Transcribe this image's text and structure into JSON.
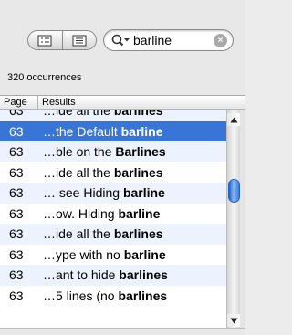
{
  "search": {
    "query": "barline"
  },
  "status": {
    "occurrences": "320 occurrences"
  },
  "table": {
    "headers": {
      "page": "Page",
      "results": "Results"
    },
    "rows": [
      {
        "page": "63",
        "pre": "…ide all the ",
        "bold": "barlines",
        "selected": false
      },
      {
        "page": "63",
        "pre": "…the Default ",
        "bold": "barline",
        "selected": true
      },
      {
        "page": "63",
        "pre": "…ble on  the ",
        "bold": "Barlines",
        "selected": false
      },
      {
        "page": "63",
        "pre": "…ide all the ",
        "bold": "barlines",
        "selected": false
      },
      {
        "page": "63",
        "pre": "… see Hiding ",
        "bold": "barline",
        "selected": false
      },
      {
        "page": "63",
        "pre": "…ow.  Hiding ",
        "bold": "barline",
        "selected": false
      },
      {
        "page": "63",
        "pre": "…ide all the ",
        "bold": "barlines",
        "selected": false
      },
      {
        "page": "63",
        "pre": "…ype with no ",
        "bold": "barline",
        "selected": false
      },
      {
        "page": "63",
        "pre": "…ant to hide ",
        "bold": "barlines",
        "selected": false
      },
      {
        "page": "63",
        "pre": "…5 lines (no ",
        "bold": "barlines",
        "selected": false
      }
    ]
  },
  "icons": {
    "view_toggle_left": "outline-list-icon",
    "view_toggle_right": "list-icon",
    "search": "magnifier-dropdown-icon",
    "clear": "clear-search-icon"
  }
}
